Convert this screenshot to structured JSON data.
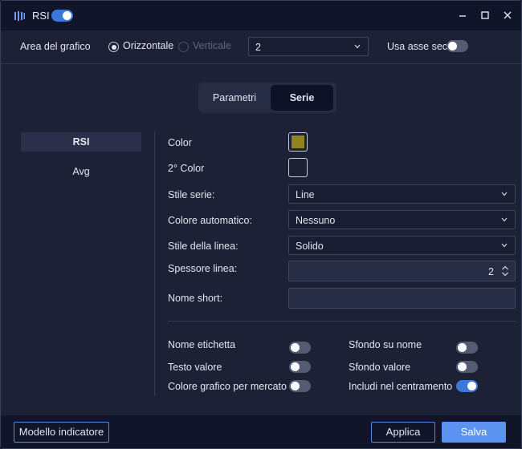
{
  "window": {
    "title": "RSI",
    "title_toggle_on": true
  },
  "area": {
    "label": "Area del grafico",
    "horizontal_label": "Orizzontale",
    "vertical_label": "Verticale",
    "selected_orientation": "Orizzontale",
    "pane_select_value": "2",
    "secondary_axis_label": "Usa asse sec.",
    "secondary_axis_on": false
  },
  "tabs": {
    "params_label": "Parametri",
    "series_label": "Serie",
    "active": "Serie"
  },
  "sidebar": {
    "items": [
      {
        "label": "RSI",
        "active": true
      },
      {
        "label": "Avg",
        "active": false
      }
    ]
  },
  "form": {
    "color_label": "Color",
    "color_value": "#8f8420",
    "color2_label": "2° Color",
    "series_style_label": "Stile serie:",
    "series_style_value": "Line",
    "auto_color_label": "Colore automatico:",
    "auto_color_value": "Nessuno",
    "line_style_label": "Stile della linea:",
    "line_style_value": "Solido",
    "line_width_label": "Spessore linea:",
    "line_width_value": "2",
    "short_name_label": "Nome short:",
    "short_name_value": ""
  },
  "toggles": {
    "label_name": {
      "label": "Nome etichetta",
      "on": false
    },
    "value_text": {
      "label": "Testo valore",
      "on": false
    },
    "market_chart_color": {
      "label": "Colore grafico per mercato",
      "on": false
    },
    "name_background": {
      "label": "Sfondo su nome",
      "on": false
    },
    "value_background": {
      "label": "Sfondo valore",
      "on": false
    },
    "include_centering": {
      "label": "Includi nel centramento",
      "on": true
    }
  },
  "footer": {
    "template_button": "Modello indicatore",
    "apply_button": "Applica",
    "save_button": "Salva"
  },
  "colors": {
    "accent": "#3b78d8",
    "primary_button": "#5d93f0",
    "background": "#1c2136",
    "titlebar": "#11152a"
  }
}
